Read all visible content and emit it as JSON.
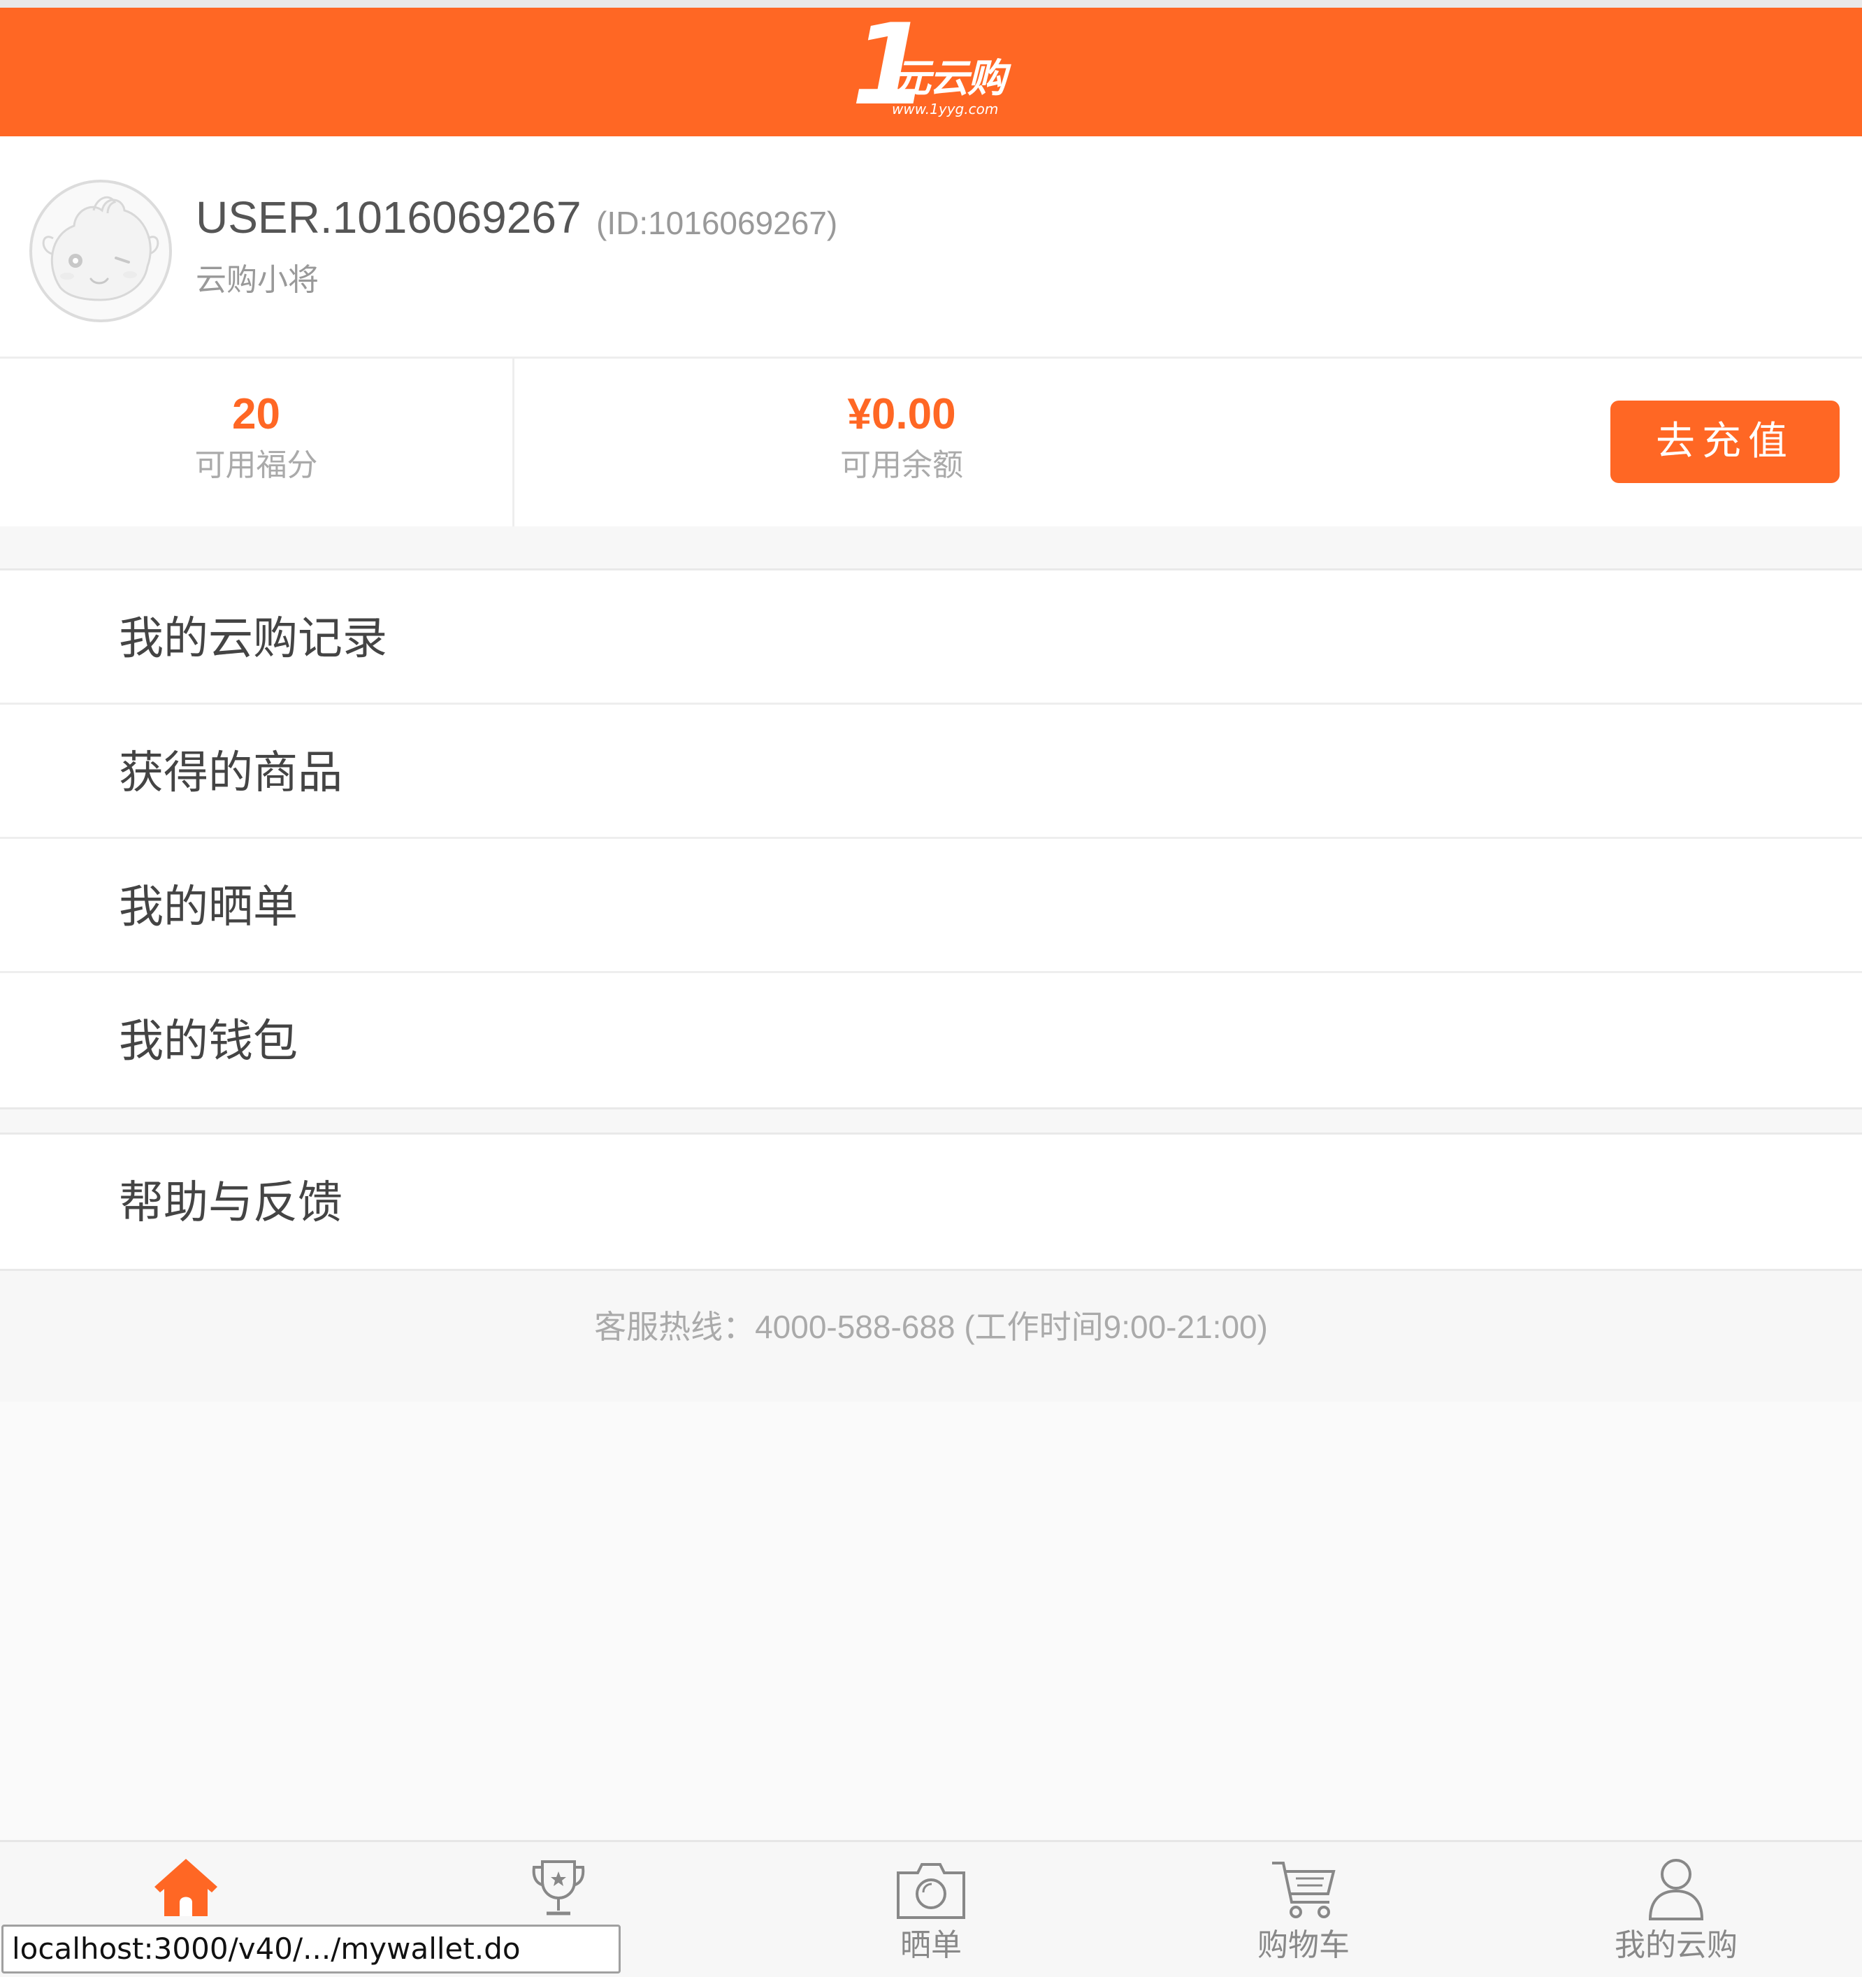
{
  "header": {
    "logo_number": "1",
    "logo_text": "元云购",
    "logo_url": "www.1yyg.com"
  },
  "profile": {
    "username": "USER.1016069267",
    "user_id": "(ID:1016069267)",
    "level": "云购小将"
  },
  "stats": {
    "points_value": "20",
    "points_label": "可用福分",
    "balance_value": "¥0.00",
    "balance_label": "可用余额",
    "recharge_label": "去充值"
  },
  "menu": {
    "items": [
      {
        "label": "我的云购记录"
      },
      {
        "label": "获得的商品"
      },
      {
        "label": "我的晒单"
      },
      {
        "label": "我的钱包"
      }
    ],
    "help_label": "帮助与反馈"
  },
  "hotline": "客服热线：4000-588-688 (工作时间9:00-21:00)",
  "tabbar": {
    "tabs": [
      {
        "label": "",
        "icon": "home-icon",
        "active": true
      },
      {
        "label": "",
        "icon": "trophy-icon"
      },
      {
        "label": "晒单",
        "icon": "camera-icon"
      },
      {
        "label": "购物车",
        "icon": "cart-icon"
      },
      {
        "label": "我的云购",
        "icon": "user-icon"
      }
    ]
  },
  "status_bar": {
    "url": "localhost:3000/v40/.../mywallet.do"
  },
  "colors": {
    "accent": "#ff6724",
    "text": "#444444",
    "muted": "#999999",
    "background": "#f7f7f7"
  }
}
